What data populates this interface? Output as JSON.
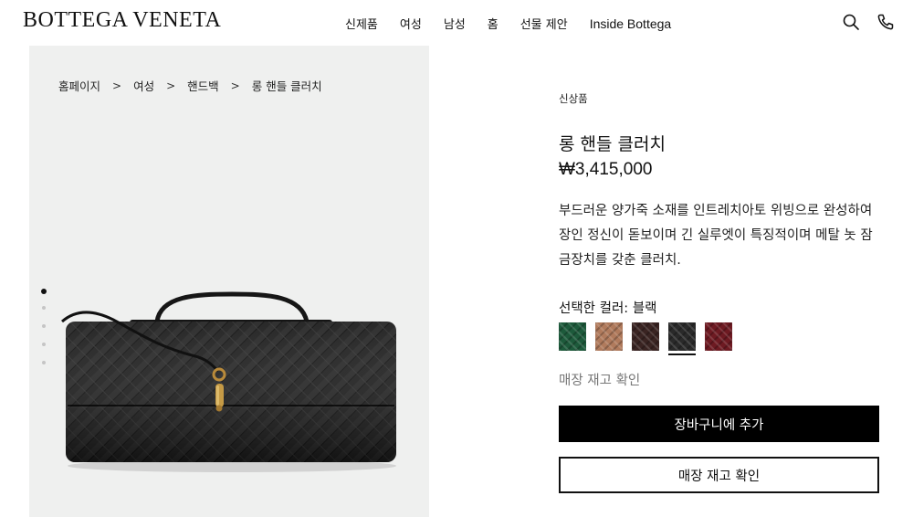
{
  "header": {
    "logo": "BOTTEGA VENETA",
    "nav": [
      "신제품",
      "여성",
      "남성",
      "홈",
      "선물 제안",
      "Inside Bottega"
    ],
    "icons": [
      "search-icon",
      "phone-icon"
    ]
  },
  "breadcrumb": {
    "items": [
      "홈페이지",
      "여성",
      "핸드백",
      "롱 핸들 클러치"
    ],
    "separator": ">"
  },
  "gallery": {
    "image_count": 5,
    "active_index": 0,
    "image_subject": "black intrecciato woven leather long clutch with top handle and gold knot clasp"
  },
  "product": {
    "badge": "신상품",
    "title": "롱 핸들 클러치",
    "price": "₩3,415,000",
    "description": "부드러운 양가죽 소재를 인트레치아토 위빙으로 완성하여 장인 정신이 돋보이며 긴 실루엣이 특징적이며 메탈 놋 잠금장치를 갖춘 클러치.",
    "color_label": "선택한 컬러:",
    "color_value": "블랙",
    "swatches": [
      {
        "name": "green",
        "color": "#1d5a3b"
      },
      {
        "name": "tan",
        "color": "#b07a5c"
      },
      {
        "name": "dark-brown",
        "color": "#3a2422"
      },
      {
        "name": "black",
        "color": "#2a2a2a",
        "selected": true
      },
      {
        "name": "burgundy",
        "color": "#6e1a22"
      }
    ],
    "stock_link": "매장 재고 확인",
    "add_to_cart": "장바구니에 추가",
    "check_stock_button": "매장 재고 확인"
  }
}
